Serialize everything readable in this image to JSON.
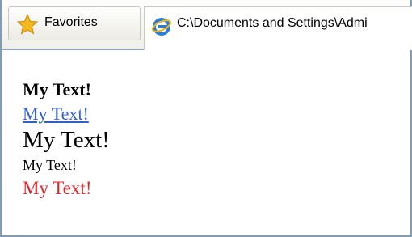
{
  "toolbar": {
    "favorites_label": "Favorites",
    "favorites_icon": "star-icon",
    "tab": {
      "icon": "ie-icon",
      "title": "C:\\Documents and Settings\\Admi"
    }
  },
  "content": {
    "lines": [
      {
        "text": "My Text!",
        "style": "bold"
      },
      {
        "text": "My Text!",
        "style": "link",
        "color": "#2f5fd2"
      },
      {
        "text": "My Text!",
        "style": "large"
      },
      {
        "text": "My Text!",
        "style": "small"
      },
      {
        "text": "My Text!",
        "style": "red",
        "color": "#e0262b"
      }
    ]
  }
}
